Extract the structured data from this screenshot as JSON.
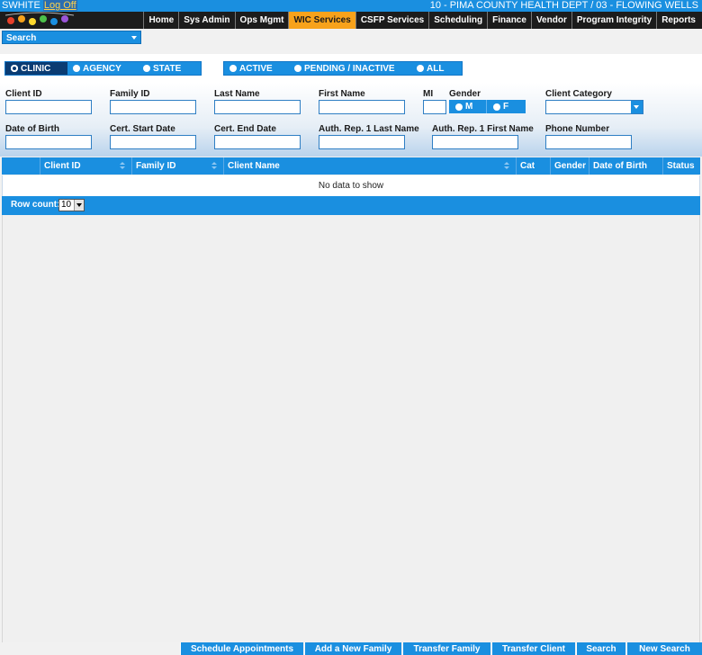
{
  "header": {
    "user": "SWHITE",
    "logoff": "Log Off",
    "agency": "10 - PIMA COUNTY HEALTH DEPT / 03 - FLOWING WELLS"
  },
  "nav": {
    "items": [
      "Home",
      "Sys Admin",
      "Ops Mgmt",
      "WIC Services",
      "CSFP Services",
      "Scheduling",
      "Finance",
      "Vendor",
      "Program Integrity",
      "Reports"
    ],
    "active": "WIC Services"
  },
  "search_dropdown": {
    "label": "Search"
  },
  "scope": {
    "options": [
      "CLINIC",
      "AGENCY",
      "STATE"
    ],
    "selected": "CLINIC"
  },
  "status": {
    "options": [
      "ACTIVE",
      "PENDING / INACTIVE",
      "ALL"
    ]
  },
  "filters": {
    "client_id": "Client ID",
    "family_id": "Family ID",
    "last_name": "Last Name",
    "first_name": "First Name",
    "mi": "MI",
    "gender": "Gender",
    "gender_m": "M",
    "gender_f": "F",
    "client_category": "Client Category",
    "dob": "Date of Birth",
    "cert_start": "Cert. Start Date",
    "cert_end": "Cert. End Date",
    "auth_last": "Auth. Rep. 1 Last Name",
    "auth_first": "Auth. Rep. 1 First Name",
    "phone": "Phone Number"
  },
  "grid": {
    "columns": [
      "Client ID",
      "Family ID",
      "Client Name",
      "Cat",
      "Gender",
      "Date of Birth",
      "Status"
    ],
    "empty_text": "No data to show",
    "row_count_label": "Row count:",
    "row_count_value": "10"
  },
  "buttons": {
    "schedule": "Schedule Appointments",
    "add_family": "Add a New Family",
    "transfer_family": "Transfer Family",
    "transfer_client": "Transfer Client",
    "search": "Search",
    "new_search": "New Search"
  },
  "colors": {
    "primary": "#1a8fe0",
    "nav_active": "#f7a21b",
    "selected_segment": "#0a3c73"
  }
}
